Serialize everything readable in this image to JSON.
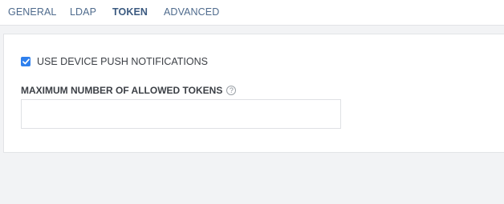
{
  "tabs": [
    {
      "label": "GENERAL",
      "active": false
    },
    {
      "label": "LDAP",
      "active": false
    },
    {
      "label": "TOKEN",
      "active": true
    },
    {
      "label": "ADVANCED",
      "active": false
    }
  ],
  "token_settings": {
    "push_notifications": {
      "label": "USE DEVICE PUSH NOTIFICATIONS",
      "checked": true
    },
    "max_tokens": {
      "label": "MAXIMUM NUMBER OF ALLOWED TOKENS",
      "help_icon": "question-circle-icon",
      "help_glyph": "?",
      "value": "",
      "placeholder": ""
    }
  },
  "colors": {
    "accent": "#2f80ed",
    "tab_text": "#4f6b8d",
    "background": "#f2f3f5"
  }
}
